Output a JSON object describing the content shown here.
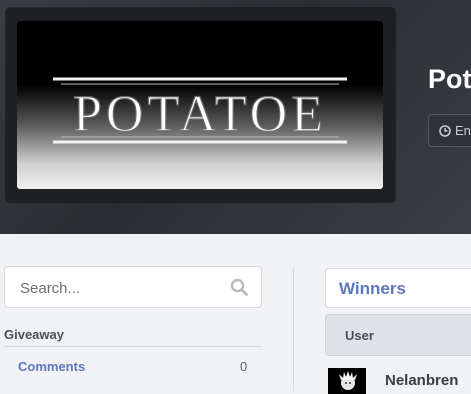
{
  "hero": {
    "title": "Pot",
    "ends_label": "En",
    "banner_text": "POTATOE",
    "clock_icon": "clock-icon"
  },
  "sidebar": {
    "search_placeholder": "Search...",
    "search_icon": "search-icon",
    "section_label": "Giveaway",
    "comments_label": "Comments",
    "comments_count": "0"
  },
  "winners": {
    "title": "Winners",
    "column_user": "User",
    "rows": [
      {
        "name": "Nelanbren"
      }
    ]
  },
  "colors": {
    "link": "#5d78bd",
    "hero_bg": "#2f3237"
  }
}
